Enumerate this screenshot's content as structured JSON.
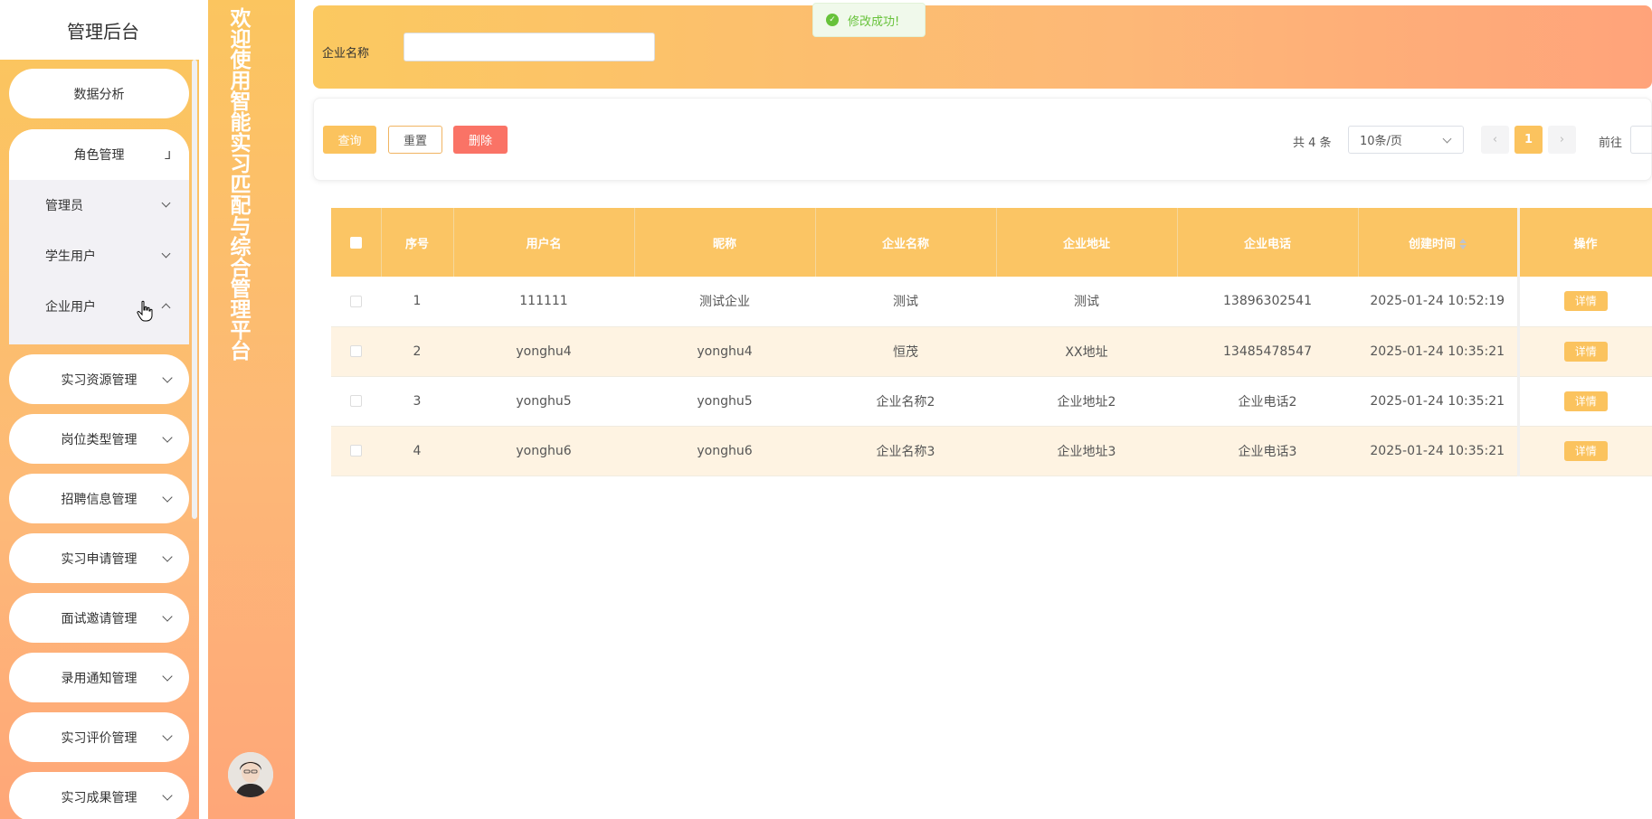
{
  "sidebar": {
    "title": "管理后台",
    "menu": [
      {
        "label": "数据分析"
      },
      {
        "label": "实习资源管理"
      },
      {
        "label": "岗位类型管理"
      },
      {
        "label": "招聘信息管理"
      },
      {
        "label": "实习申请管理"
      },
      {
        "label": "面试邀请管理"
      },
      {
        "label": "录用通知管理"
      },
      {
        "label": "实习评价管理"
      },
      {
        "label": "实习成果管理"
      }
    ],
    "role_group": {
      "label": "角色管理",
      "children": [
        {
          "label": "管理员"
        },
        {
          "label": "学生用户"
        },
        {
          "label": "企业用户"
        }
      ]
    }
  },
  "banner": {
    "text": "欢迎使用智能实习匹配与综合管理平台"
  },
  "search": {
    "label": "企业名称",
    "value": ""
  },
  "actions": {
    "query": "查询",
    "reset": "重置",
    "delete": "删除"
  },
  "pagination": {
    "total": "共 4 条",
    "page_size": "10条/页",
    "current": "1",
    "goto_label": "前往"
  },
  "table": {
    "headers": {
      "index": "序号",
      "username": "用户名",
      "nickname": "昵称",
      "company_name": "企业名称",
      "company_address": "企业地址",
      "company_phone": "企业电话",
      "created_at": "创建时间",
      "actions": "操作"
    },
    "rows": [
      {
        "index": "1",
        "username": "111111",
        "nickname": "测试企业",
        "company_name": "测试",
        "company_address": "测试",
        "company_phone": "13896302541",
        "created_at": "2025-01-24 10:52:19",
        "action": "详情"
      },
      {
        "index": "2",
        "username": "yonghu4",
        "nickname": "yonghu4",
        "company_name": "恒茂",
        "company_address": "XX地址",
        "company_phone": "13485478547",
        "created_at": "2025-01-24 10:35:21",
        "action": "详情"
      },
      {
        "index": "3",
        "username": "yonghu5",
        "nickname": "yonghu5",
        "company_name": "企业名称2",
        "company_address": "企业地址2",
        "company_phone": "企业电话2",
        "created_at": "2025-01-24 10:35:21",
        "action": "详情"
      },
      {
        "index": "4",
        "username": "yonghu6",
        "nickname": "yonghu6",
        "company_name": "企业名称3",
        "company_address": "企业地址3",
        "company_phone": "企业电话3",
        "created_at": "2025-01-24 10:35:21",
        "action": "详情"
      }
    ]
  },
  "toast": {
    "message": "修改成功!",
    "icon": "check-circle-icon"
  },
  "colors": {
    "accent": "#fbc35e",
    "danger": "#fa7366",
    "success": "#67c23a"
  }
}
